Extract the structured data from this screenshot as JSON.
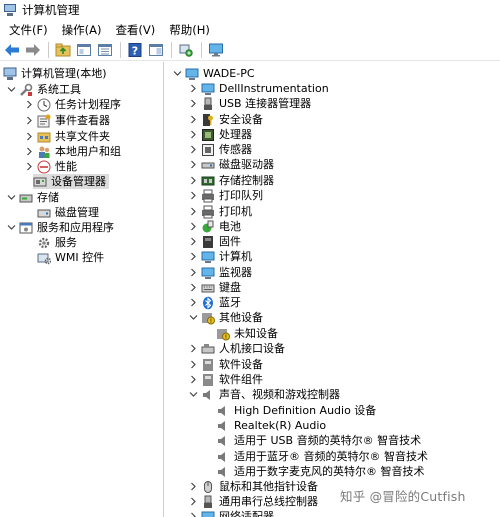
{
  "window": {
    "title": "计算机管理"
  },
  "menubar": {
    "items": [
      "文件(F)",
      "操作(A)",
      "查看(V)",
      "帮助(H)"
    ]
  },
  "toolbar": {
    "buttons": [
      "back-arrow-icon",
      "forward-arrow-icon",
      "up-folder-icon",
      "properties-icon",
      "show-hide-tree-icon",
      "help-icon",
      "console-view-icon",
      "scan-hardware-icon",
      "monitor-icon"
    ]
  },
  "left_tree": {
    "root": "计算机管理(本地)",
    "system_tools": "系统工具",
    "task_scheduler": "任务计划程序",
    "event_viewer": "事件查看器",
    "shared_folders": "共享文件夹",
    "local_users": "本地用户和组",
    "performance": "性能",
    "device_manager": "设备管理器",
    "storage": "存储",
    "disk_management": "磁盘管理",
    "services_apps": "服务和应用程序",
    "services": "服务",
    "wmi": "WMI 控件"
  },
  "device_tree": {
    "computer_name": "WADE-PC",
    "categories": [
      "DellInstrumentation",
      "USB 连接器管理器",
      "安全设备",
      "处理器",
      "传感器",
      "磁盘驱动器",
      "存储控制器",
      "打印队列",
      "打印机",
      "电池",
      "固件",
      "计算机",
      "监视器",
      "键盘",
      "蓝牙",
      "其他设备",
      "未知设备",
      "人机接口设备",
      "软件设备",
      "软件组件",
      "声音、视频和游戏控制器",
      "High Definition Audio 设备",
      "Realtek(R) Audio",
      "适用于 USB 音频的英特尔® 智音技术",
      "适用于蓝牙® 音频的英特尔® 智音技术",
      "适用于数字麦克风的英特尔® 智音技术",
      "鼠标和其他指针设备",
      "通用串行总线控制器",
      "网络适配器"
    ]
  },
  "watermark": "知乎 @冒险的Cutfish"
}
